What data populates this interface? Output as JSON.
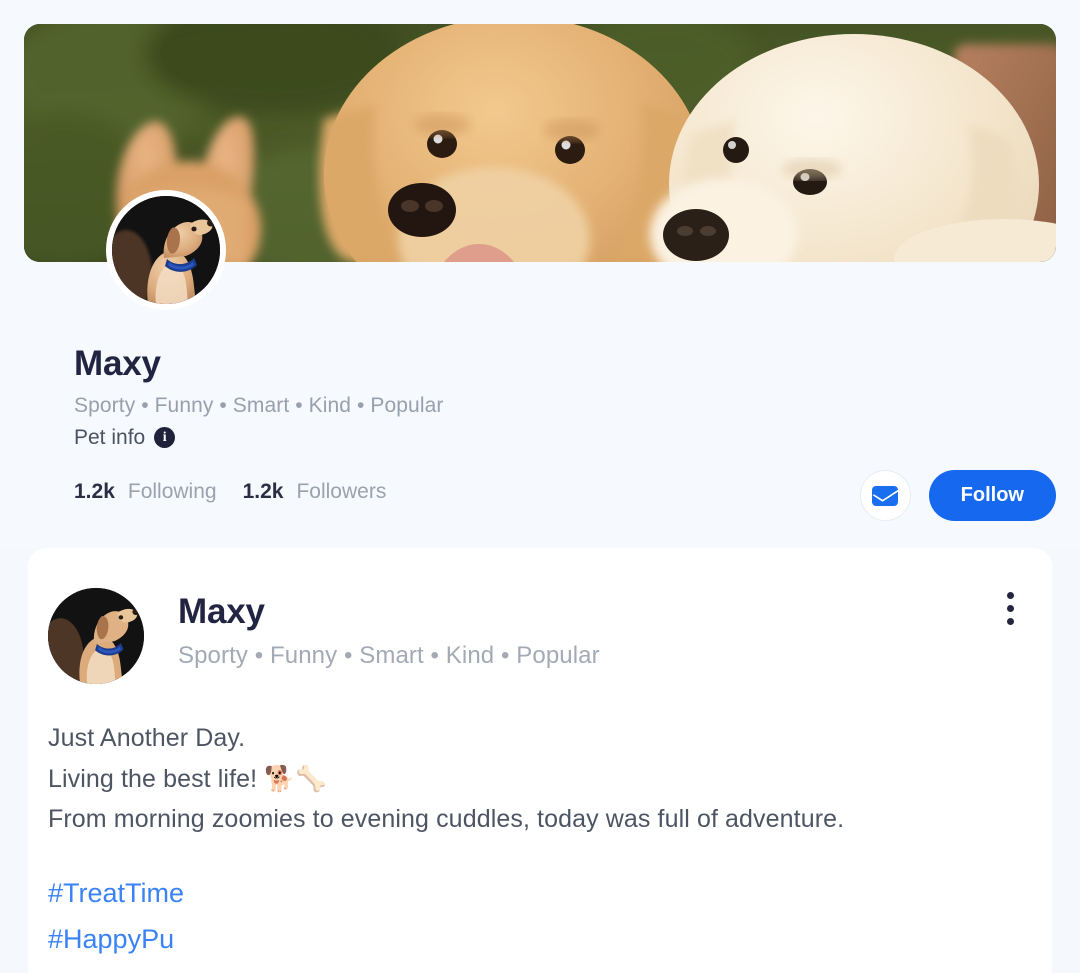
{
  "profile": {
    "cover_alt": "two-golden-retrievers-outdoors",
    "avatar_alt": "tan-dog-with-blue-collar",
    "name": "Maxy",
    "tags": "Sporty • Funny • Smart • Kind • Popular",
    "pet_info_label": "Pet info",
    "info_icon_glyph": "i",
    "stats": {
      "following_count": "1.2k",
      "following_label": "Following",
      "followers_count": "1.2k",
      "followers_label": "Followers"
    },
    "actions": {
      "message_icon": "envelope-icon",
      "follow_label": "Follow"
    }
  },
  "post": {
    "avatar_alt": "tan-dog-with-blue-collar",
    "author": "Maxy",
    "tags": "Sporty • Funny • Smart • Kind • Popular",
    "menu_icon": "more-vertical-icon",
    "lines": [
      "Just Another Day.",
      "Living the best life! 🐕🦴",
      "From morning zoomies to evening cuddles, today was full of adventure."
    ],
    "hashtags": [
      "#TreatTime",
      "#HappyPu"
    ]
  },
  "colors": {
    "accent_blue": "#1668ef",
    "link_blue": "#3a82f6",
    "page_bg": "#f5f8fd",
    "profile_bg": "#f6f9fd",
    "card_bg": "#ffffff",
    "heading": "#212541",
    "muted": "#9aa2ae"
  }
}
